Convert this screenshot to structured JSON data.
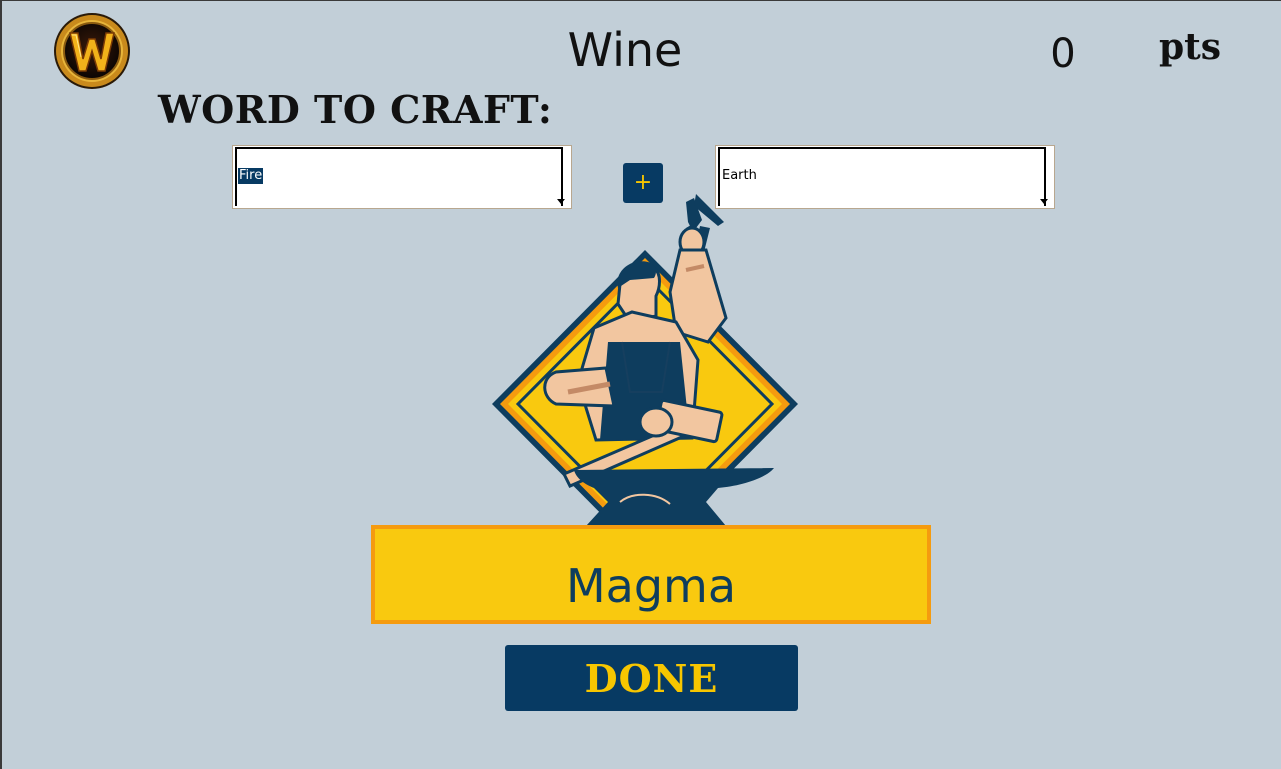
{
  "header": {
    "target_word": "Wine",
    "score": "0",
    "score_unit": "pts"
  },
  "craft": {
    "label": "WORD TO CRAFT:",
    "left_select": {
      "selected": "Fire"
    },
    "plus_label": "+",
    "right_select": {
      "selected": "Earth"
    }
  },
  "result": {
    "word": "Magma"
  },
  "actions": {
    "done_label": "DONE"
  },
  "icons": {
    "logo": "warcraft-w-logo-icon",
    "illustration": "blacksmith-anvil-icon"
  },
  "colors": {
    "background": "#c2cfd8",
    "navy": "#073a63",
    "gold": "#f7c600",
    "result_fill": "#f9c90f",
    "result_border": "#f59b0f"
  }
}
